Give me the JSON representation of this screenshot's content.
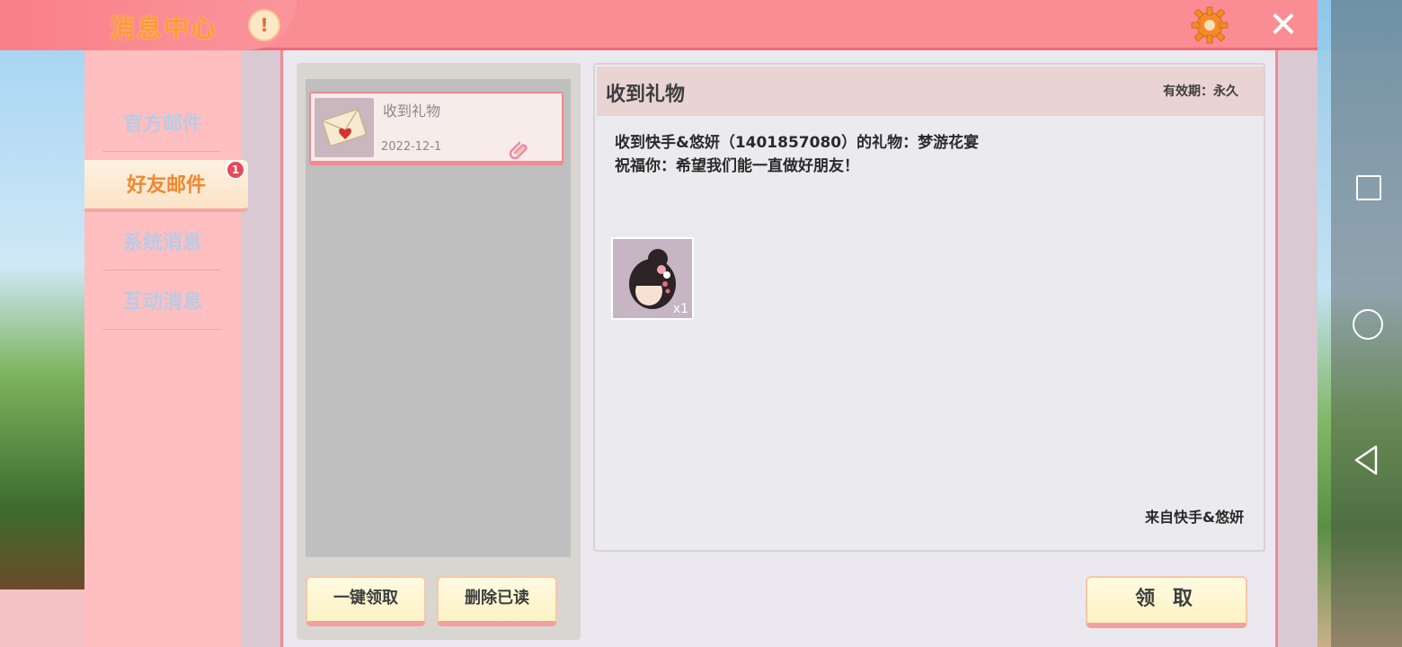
{
  "window": {
    "title": "消息中心",
    "info_glyph": "!",
    "close_glyph": "✕"
  },
  "sidebar": {
    "items": [
      {
        "label": "官方邮件",
        "active": false
      },
      {
        "label": "好友邮件",
        "active": true,
        "badge": "1"
      },
      {
        "label": "系统消息",
        "active": false
      },
      {
        "label": "互动消息",
        "active": false
      }
    ]
  },
  "mail_list": {
    "items": [
      {
        "title": "收到礼物",
        "date": "2022-12-1",
        "icon": "envelope-icon",
        "has_attachment": true
      }
    ],
    "collect_all_label": "一键领取",
    "delete_read_label": "删除已读"
  },
  "detail": {
    "title": "收到礼物",
    "validity": "有效期：永久",
    "body_line1": "收到快手&悠妍（1401857080）的礼物：梦游花宴",
    "body_line2": "祝福你：希望我们能一直做好朋友！",
    "gift": {
      "icon": "hair-accessory-icon",
      "quantity": "x1"
    },
    "sender": "来自快手&悠妍",
    "claim_label": "领 取"
  },
  "colors": {
    "title_bar": "#fa8c93",
    "title_text": "#ff9a3a",
    "sidebar_bg": "#ffbfc1",
    "active_tab_text": "#f4862e",
    "badge": "#e8485a",
    "button_bg": "#fdf2c4"
  }
}
